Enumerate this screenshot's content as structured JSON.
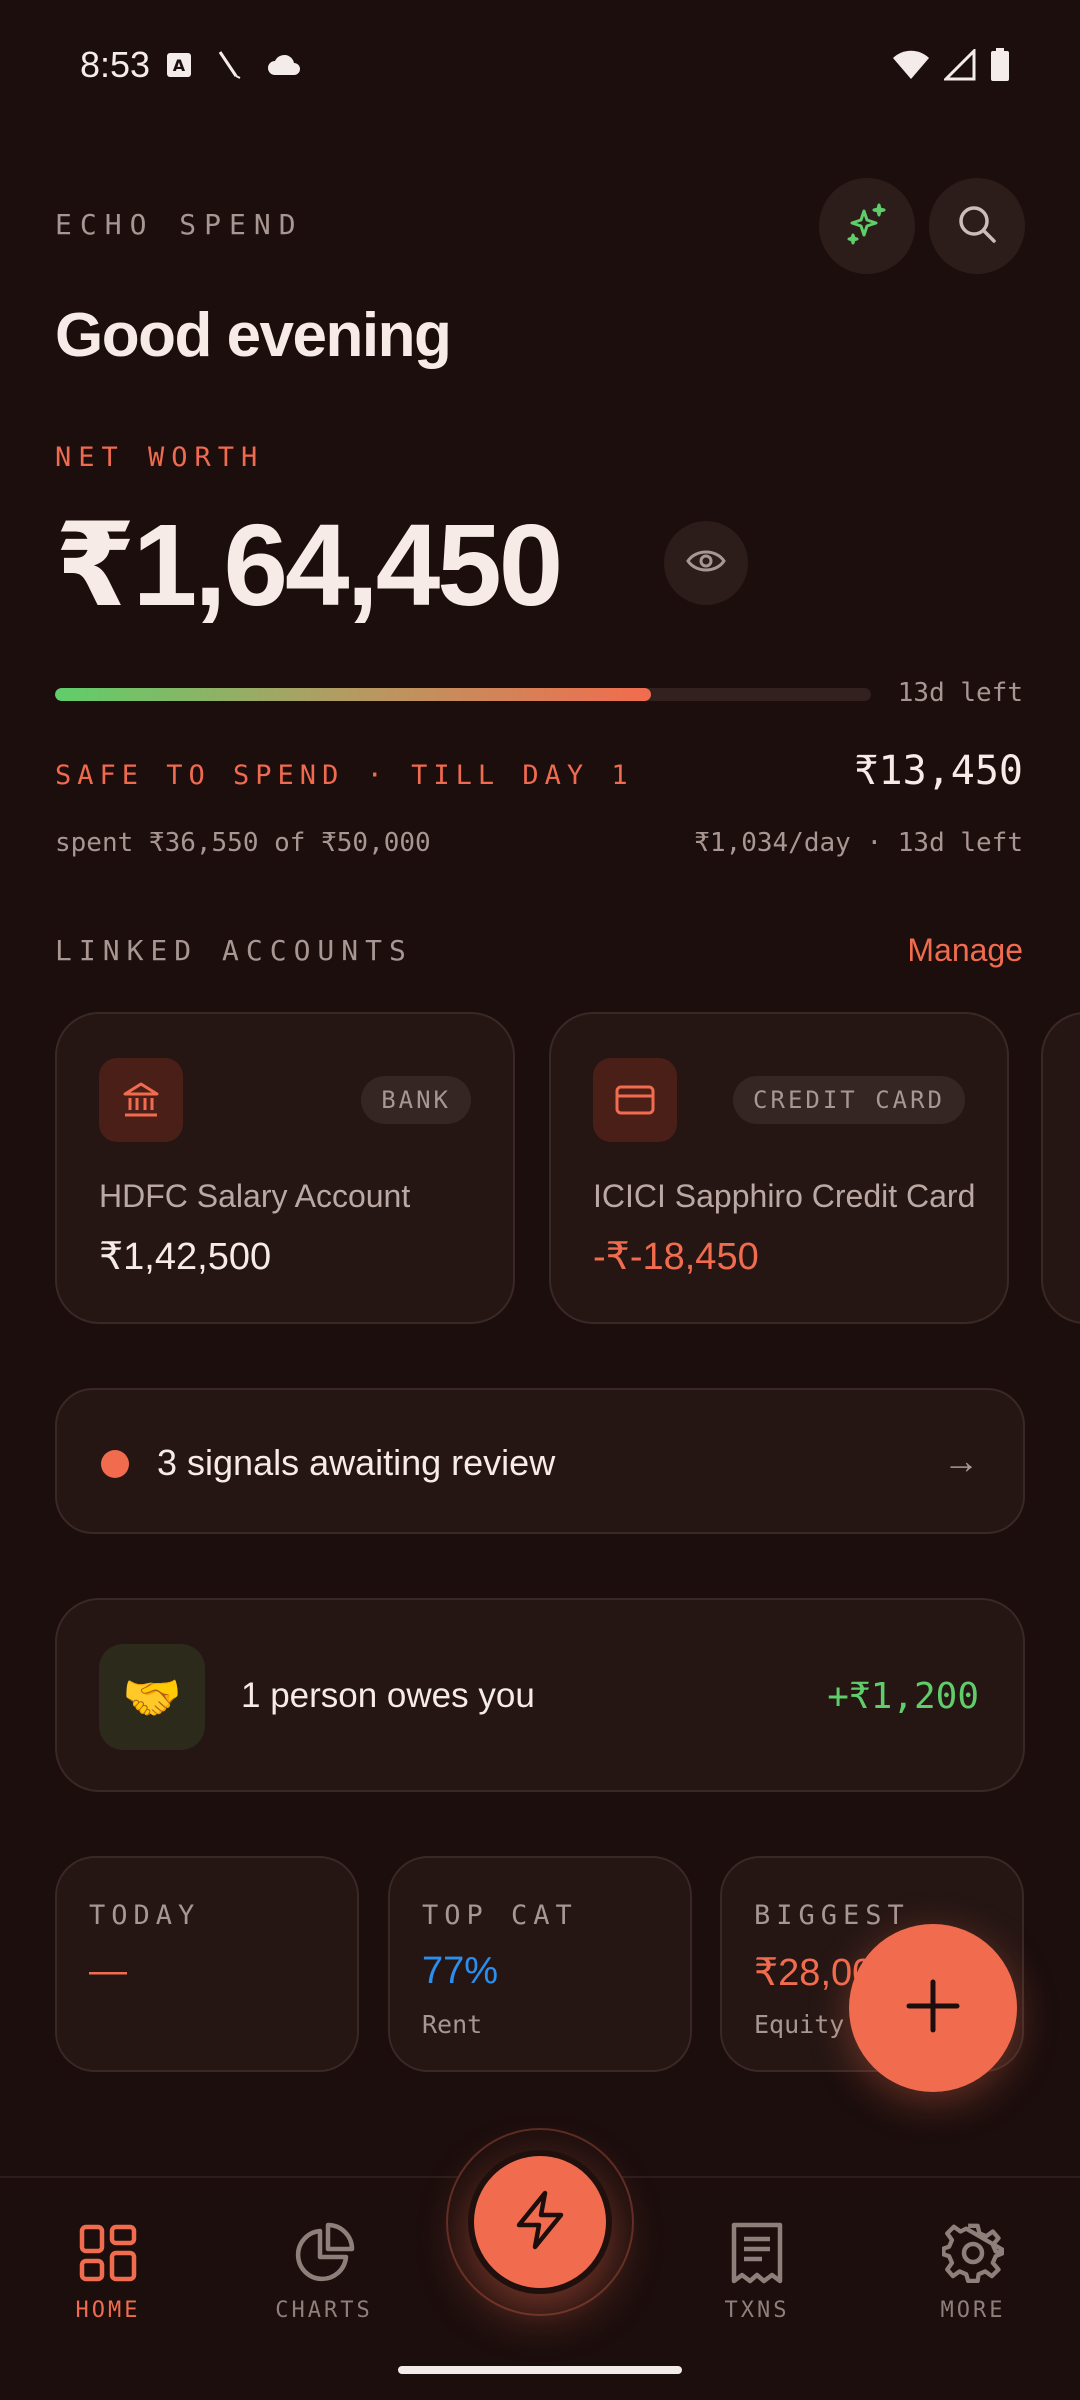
{
  "status_bar": {
    "time": "8:53"
  },
  "header": {
    "brand": "ECHO SPEND",
    "greeting": "Good evening"
  },
  "net_worth": {
    "label": "NET WORTH",
    "value": "₹1,64,450"
  },
  "budget": {
    "progress": 0.731,
    "days_left": "13d left",
    "safe_label": "SAFE TO SPEND · TILL DAY 1",
    "safe_value": "₹13,450",
    "spent": "spent ₹36,550 of ₹50,000",
    "per_day": "₹1,034/day · 13d left"
  },
  "accounts": {
    "label": "LINKED ACCOUNTS",
    "manage": "Manage",
    "items": [
      {
        "badge": "BANK",
        "name": "HDFC Salary Account",
        "balance": "₹1,42,500"
      },
      {
        "badge": "CREDIT CARD",
        "name": "ICICI Sapphiro Credit Card",
        "balance": "-₹-18,450"
      }
    ]
  },
  "signals": {
    "text": "3 signals awaiting review",
    "arrow": "→"
  },
  "owes": {
    "icon": "🤝",
    "text": "1 person owes you",
    "amount": "+₹1,200"
  },
  "stats": [
    {
      "label": "TODAY",
      "value": "—",
      "sub": ""
    },
    {
      "label": "TOP CAT",
      "value": "77%",
      "sub": "Rent"
    },
    {
      "label": "BIGGEST",
      "value": "₹28,000",
      "sub": "Equity"
    }
  ],
  "nav": {
    "home": "HOME",
    "charts": "CHARTS",
    "txns": "TXNS",
    "more": "MORE"
  },
  "colors": {
    "accent": "#f16c4e",
    "positive": "#5fce6a",
    "blue": "#2b8ff0",
    "background": "#1b0e0d"
  }
}
